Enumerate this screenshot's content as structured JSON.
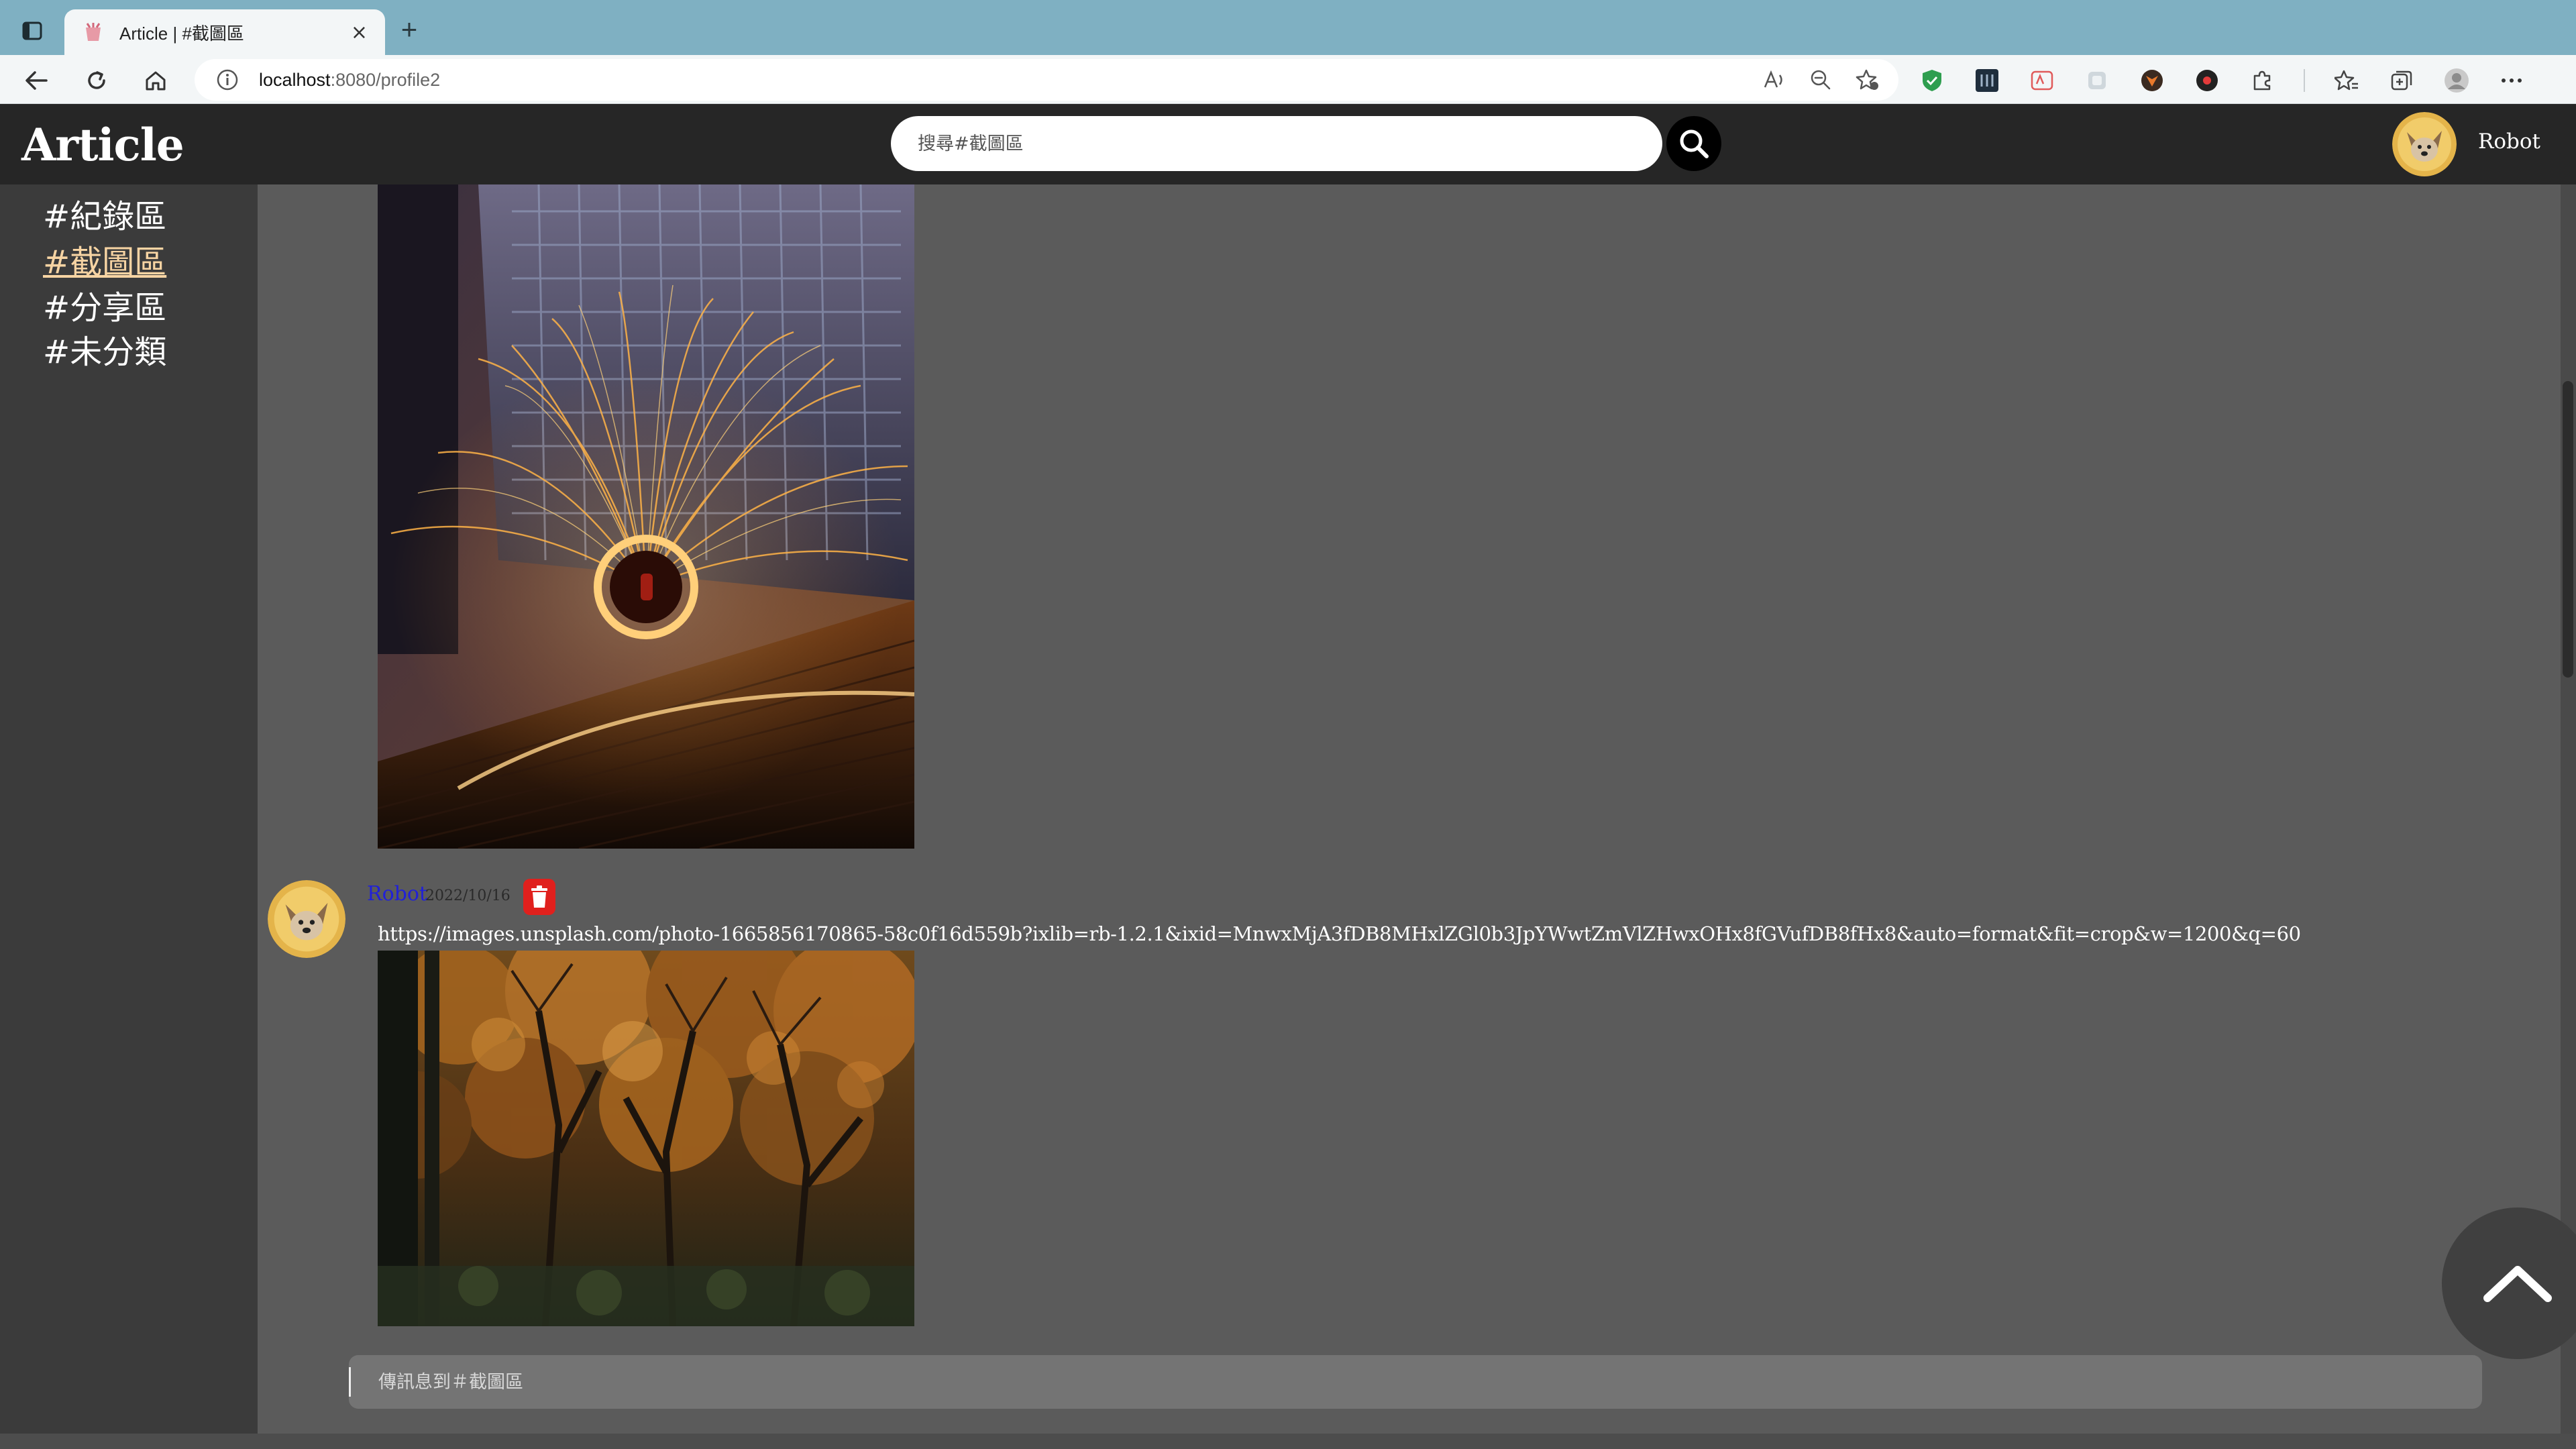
{
  "browser": {
    "tab_title": "Article | #截圖區",
    "tab_close": "×",
    "new_tab": "+",
    "url_host": "localhost",
    "url_rest": ":8080/profile2"
  },
  "app": {
    "brand": "Article",
    "search_placeholder": "搜尋#截圖區",
    "user_name": "Robot"
  },
  "sidebar": {
    "channels": [
      {
        "label": "#紀錄區",
        "active": false
      },
      {
        "label": "#截圖區",
        "active": true
      },
      {
        "label": "#分享區",
        "active": false
      },
      {
        "label": "#未分類",
        "active": false
      }
    ]
  },
  "posts": [
    {
      "author": "Robot",
      "date": "2022/10/16",
      "text": "https://images.unsplash.com/photo-1665856170865-58c0f16d559b?ixlib=rb-1.2.1&ixid=MnwxMjA3fDB8MHxlZGl0b3JpYWwtZmVlZHwxOHx8fGVufDB8fHx8&auto=format&fit=crop&w=1200&q=60"
    }
  ],
  "composer": {
    "placeholder": "傳訊息到＃截圖區"
  },
  "colors": {
    "header_bg": "#262626",
    "sidebar_bg": "#3b3b3b",
    "main_bg": "#5b5b5b",
    "active_channel": "#f7d4a3",
    "author_link": "#2020d8",
    "delete_red": "#e0201d",
    "tabbar": "#7fb0c2"
  },
  "icons": {
    "tab_actions": "tab-actions-icon",
    "back": "back-arrow-icon",
    "reload": "reload-icon",
    "home": "home-icon",
    "info": "info-icon",
    "read_aloud": "read-aloud-icon",
    "zoom": "zoom-out-icon",
    "favorite": "add-favorite-icon",
    "search": "search-icon",
    "delete": "trash-icon",
    "scroll_top": "chevron-up-icon"
  }
}
